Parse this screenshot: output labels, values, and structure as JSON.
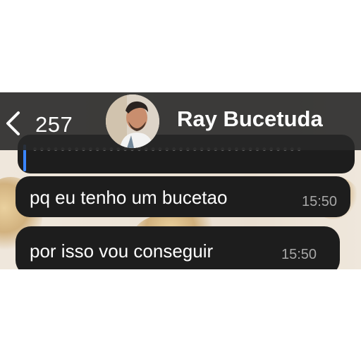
{
  "header": {
    "unread_count": "257",
    "contact_name": "Ray Bucetuda"
  },
  "messages": [
    {
      "text": "pq eu tenho um bucetao",
      "time": "15:50"
    },
    {
      "text": "por isso vou conseguir",
      "time": "15:50"
    }
  ],
  "colors": {
    "header_bg": "#282828",
    "bubble_bg": "#1d1d1d",
    "reply_accent": "#3a85ff",
    "timestamp": "#a7a7a7"
  },
  "icons": [
    "back-chevron-icon"
  ]
}
